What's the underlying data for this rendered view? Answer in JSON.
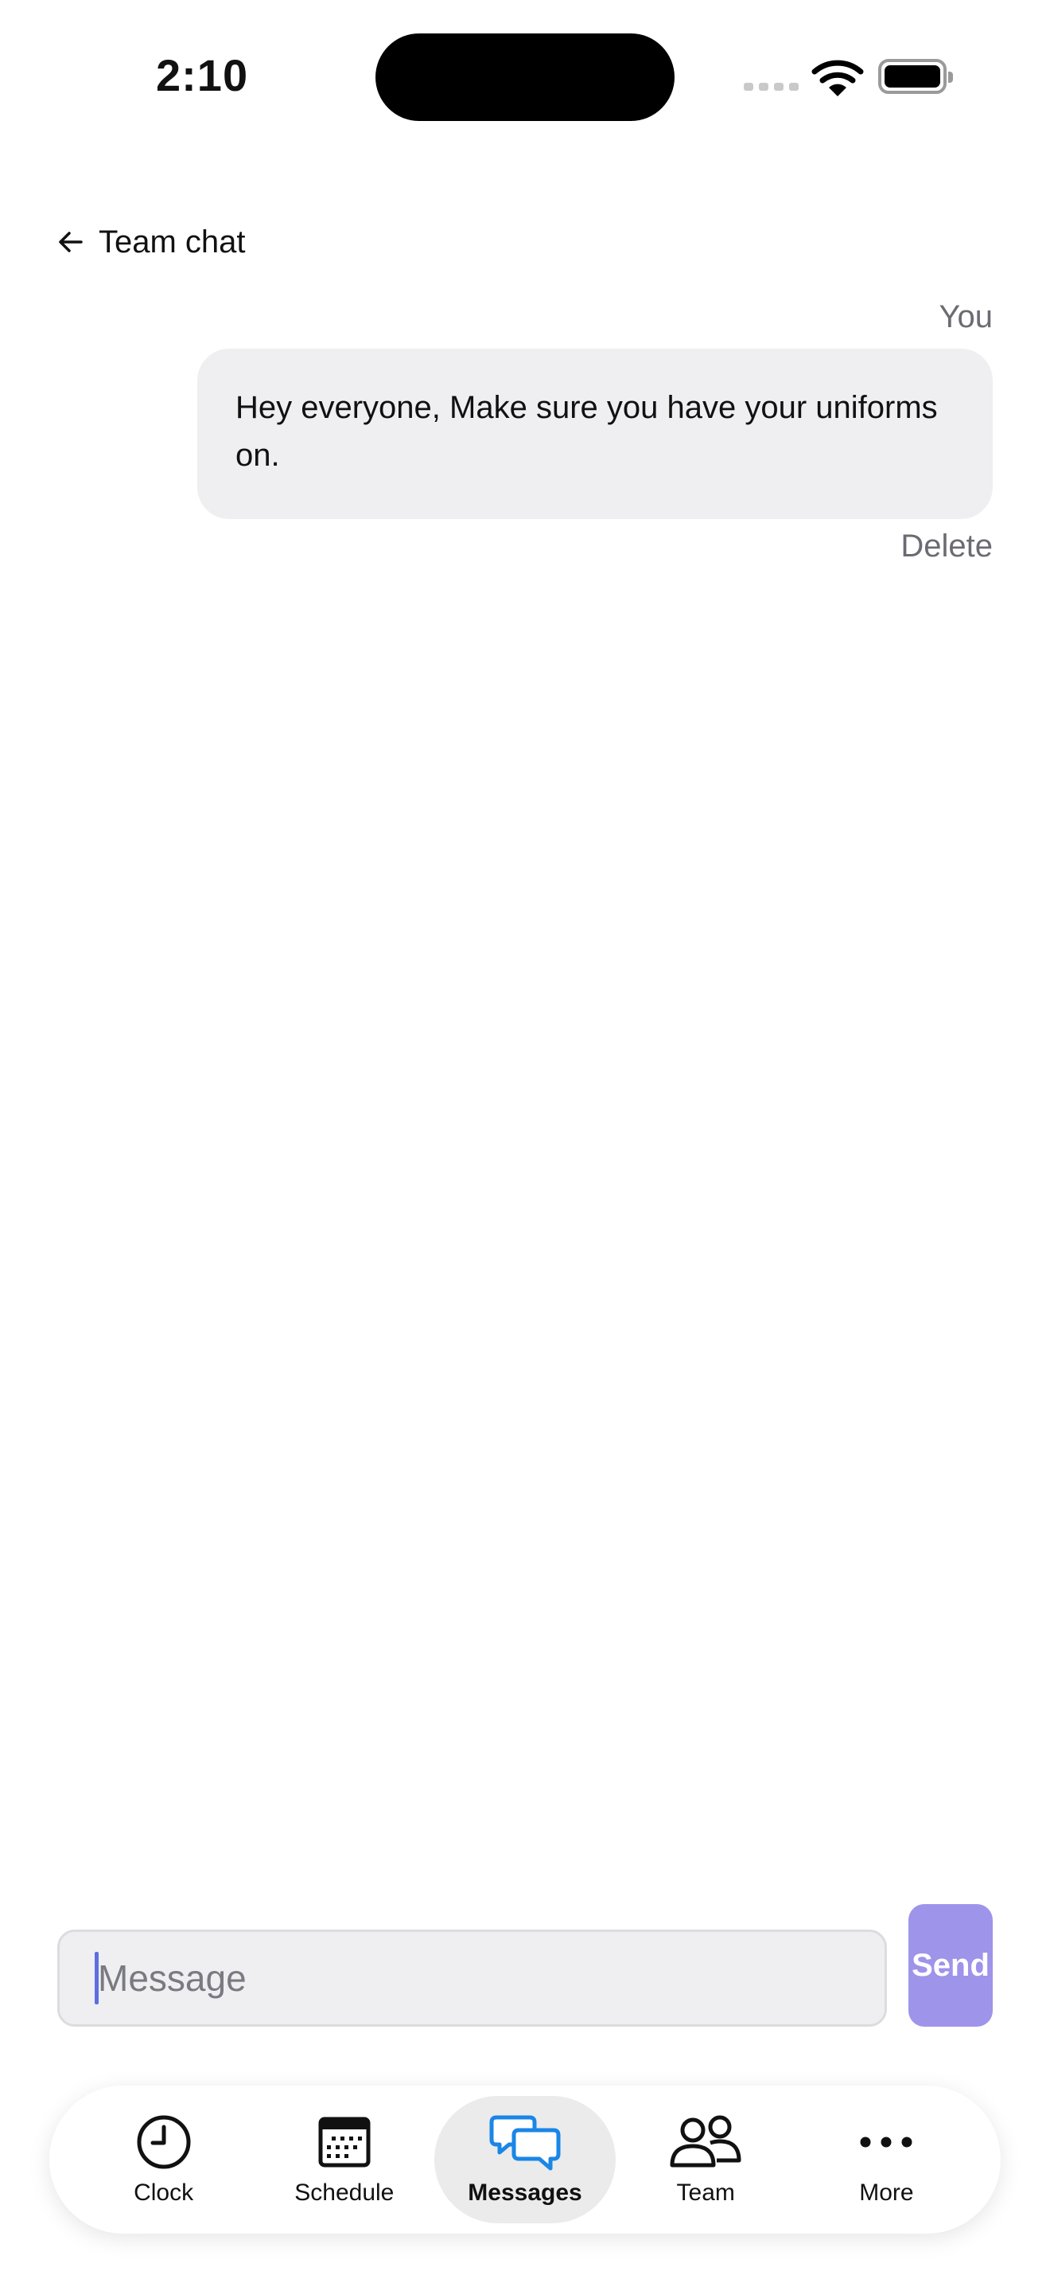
{
  "status_bar": {
    "time": "2:10"
  },
  "header": {
    "title": "Team chat"
  },
  "conversation": {
    "messages": [
      {
        "sender": "You",
        "text": "Hey everyone, Make sure you have your uniforms on.",
        "action": "Delete"
      }
    ]
  },
  "composer": {
    "placeholder": "Message",
    "value": "",
    "send_label": "Send"
  },
  "tabbar": {
    "items": [
      {
        "label": "Clock",
        "icon": "clock-icon"
      },
      {
        "label": "Schedule",
        "icon": "calendar-icon"
      },
      {
        "label": "Messages",
        "icon": "chat-bubbles-icon",
        "active": true
      },
      {
        "label": "Team",
        "icon": "people-icon"
      },
      {
        "label": "More",
        "icon": "more-dots-icon"
      }
    ]
  },
  "colors": {
    "accent": "#1a86e6",
    "send_button": "#9e94ea",
    "bubble": "#efeff1",
    "secondary_text": "#6b6b73"
  }
}
